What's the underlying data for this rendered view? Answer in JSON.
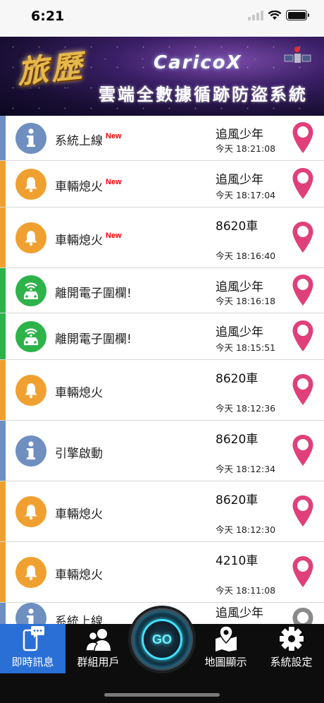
{
  "status": {
    "time": "6:21"
  },
  "banner": {
    "logo": "旅歷",
    "brand": "CaricoX",
    "subtitle": "雲端全數據循跡防盜系統"
  },
  "colors": {
    "info": "#6f8fc0",
    "alarm": "#f0a030",
    "fence": "#2db34a",
    "pin": "#e0407a",
    "pin_inactive": "#8a8a8a",
    "tab_active": "#2a6fd6"
  },
  "events": [
    {
      "type": "info",
      "label": "系統上線",
      "new": "New",
      "name": "追風少年",
      "time": "今天 18:21:08"
    },
    {
      "type": "alarm",
      "label": "車輛熄火",
      "new": "New",
      "name": "追風少年",
      "time": "今天 18:17:04"
    },
    {
      "type": "alarm",
      "label": "車輛熄火",
      "new": "New",
      "name": "8620車",
      "time": "今天 18:16:40"
    },
    {
      "type": "fence",
      "label": "離開電子圍欄!",
      "new": "",
      "name": "追風少年",
      "time": "今天 18:16:18"
    },
    {
      "type": "fence",
      "label": "離開電子圍欄!",
      "new": "",
      "name": "追風少年",
      "time": "今天 18:15:51"
    },
    {
      "type": "alarm",
      "label": "車輛熄火",
      "new": "",
      "name": "8620車",
      "time": "今天 18:12:36"
    },
    {
      "type": "info",
      "label": "引擎啟動",
      "new": "",
      "name": "8620車",
      "time": "今天 18:12:34"
    },
    {
      "type": "alarm",
      "label": "車輛熄火",
      "new": "",
      "name": "8620車",
      "time": "今天 18:12:30"
    },
    {
      "type": "alarm",
      "label": "車輛熄火",
      "new": "",
      "name": "4210車",
      "time": "今天 18:11:08"
    },
    {
      "type": "info",
      "label": "系統上線",
      "new": "",
      "name": "追風少年",
      "time": ""
    }
  ],
  "tabs": {
    "messages": "即時訊息",
    "group": "群組用戶",
    "go": "GO",
    "map": "地圖顯示",
    "settings": "系統設定"
  }
}
